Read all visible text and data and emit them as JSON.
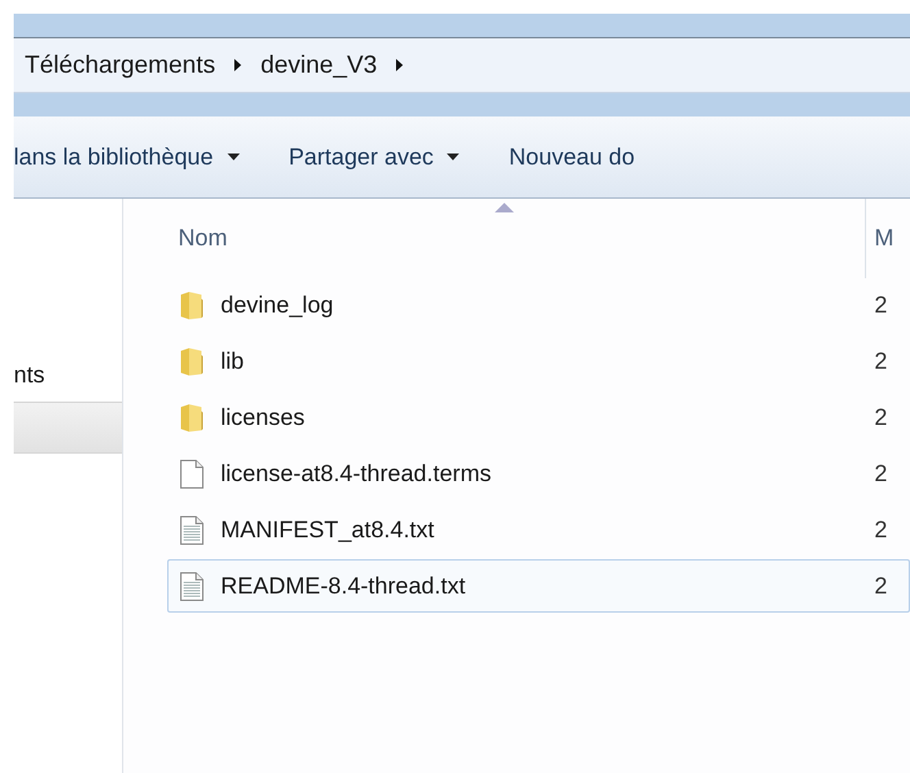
{
  "breadcrumb": [
    {
      "label": "Téléchargements"
    },
    {
      "label": "devine_V3"
    }
  ],
  "toolbar": [
    {
      "label": "lans la bibliothèque",
      "dropdown": true
    },
    {
      "label": "Partager avec",
      "dropdown": true
    },
    {
      "label": "Nouveau do",
      "dropdown": false
    }
  ],
  "sidebar": {
    "items": [
      {
        "label": "nts",
        "selected": false
      },
      {
        "selected": true
      }
    ]
  },
  "columns": [
    {
      "label": "Nom",
      "sorted": true
    },
    {
      "label": "M",
      "sorted": false
    }
  ],
  "files": [
    {
      "kind": "folder",
      "name": "devine_log",
      "date": "2",
      "focused": false
    },
    {
      "kind": "folder",
      "name": "lib",
      "date": "2",
      "focused": false
    },
    {
      "kind": "folder",
      "name": "licenses",
      "date": "2",
      "focused": false
    },
    {
      "kind": "file",
      "name": "license-at8.4-thread.terms",
      "date": "2",
      "focused": false
    },
    {
      "kind": "text",
      "name": "MANIFEST_at8.4.txt",
      "date": "2",
      "focused": false
    },
    {
      "kind": "text",
      "name": "README-8.4-thread.txt",
      "date": "2",
      "focused": true
    }
  ]
}
